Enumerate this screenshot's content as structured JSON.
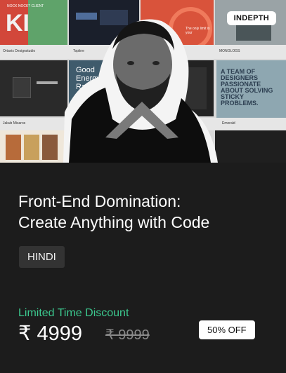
{
  "thumbnail": {
    "badge": "INDEPTH",
    "tile_texts": {
      "t1_big": "KI",
      "t1_small": "NOCK NOCK? CLIENT",
      "t2_caption": "Ortavis Designstudio",
      "t3_caption": "Topline",
      "t5_text": "The only limit is your",
      "t6_caption": "MONOLOGS",
      "t8_text": "Good Energy Radio",
      "t11_caption": "Jakub Misaros",
      "t12_caption": "Emerald",
      "poster_text": "A TEAM OF DESIGNERS PASSIONATE ABOUT SOLVING STICKY PROBLEMS."
    }
  },
  "course": {
    "title_line1": "Front-End Domination:",
    "title_line2": "Create Anything with Code",
    "language": "HINDI",
    "discount_label": "Limited Time Discount",
    "price": "₹ 4999",
    "old_price": "₹ 9999",
    "off_badge": "50% OFF"
  },
  "colors": {
    "card_bg": "#1c1c1c",
    "discount_green": "#3cc98f",
    "chip_bg": "#333333"
  }
}
